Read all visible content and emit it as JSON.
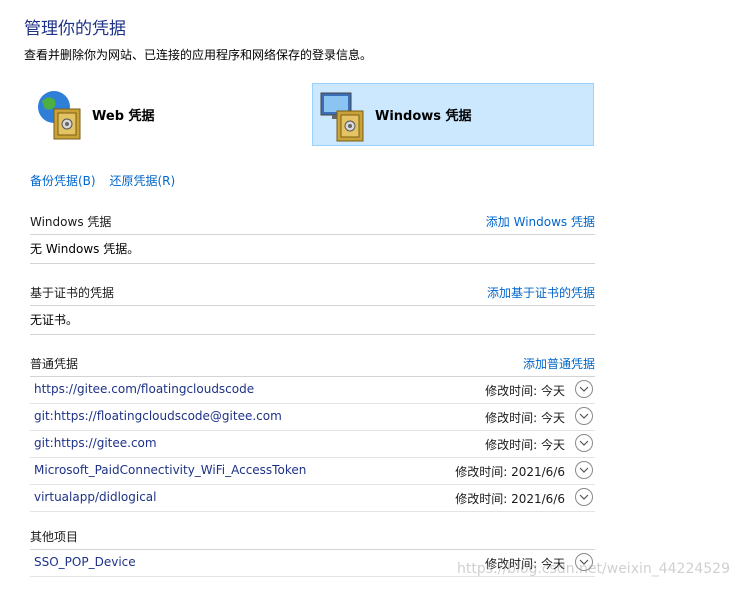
{
  "header": {
    "title": "管理你的凭据",
    "description": "查看并删除你为网站、已连接的应用程序和网络保存的登录信息。"
  },
  "vaults": {
    "web": {
      "label": "Web 凭据",
      "icon": "globe-safe-icon"
    },
    "windows": {
      "label": "Windows 凭据",
      "icon": "monitor-safe-icon",
      "selected": true
    }
  },
  "links": {
    "backup": "备份凭据(B)",
    "restore": "还原凭据(R)"
  },
  "windows_section": {
    "title": "Windows 凭据",
    "add": "添加 Windows 凭据",
    "empty": "无 Windows 凭据。"
  },
  "cert_section": {
    "title": "基于证书的凭据",
    "add": "添加基于证书的凭据",
    "empty": "无证书。"
  },
  "generic_section": {
    "title": "普通凭据",
    "add": "添加普通凭据",
    "items": [
      {
        "name": "https://gitee.com/floatingcloudscode",
        "modified": "修改时间:  今天"
      },
      {
        "name": "git:https://floatingcloudscode@gitee.com",
        "modified": "修改时间:  今天"
      },
      {
        "name": "git:https://gitee.com",
        "modified": "修改时间:  今天"
      },
      {
        "name": "Microsoft_PaidConnectivity_WiFi_AccessToken",
        "modified": "修改时间:  2021/6/6"
      },
      {
        "name": "virtualapp/didlogical",
        "modified": "修改时间:  2021/6/6"
      }
    ]
  },
  "other_section": {
    "title": "其他项目",
    "items": [
      {
        "name": "SSO_POP_Device",
        "modified": "修改时间:  今天"
      }
    ]
  },
  "watermark": "https://blog.csdn.net/weixin_44224529",
  "colors": {
    "accent": "#0066cc",
    "selected_bg": "#cce8ff",
    "title": "#1e3287"
  }
}
